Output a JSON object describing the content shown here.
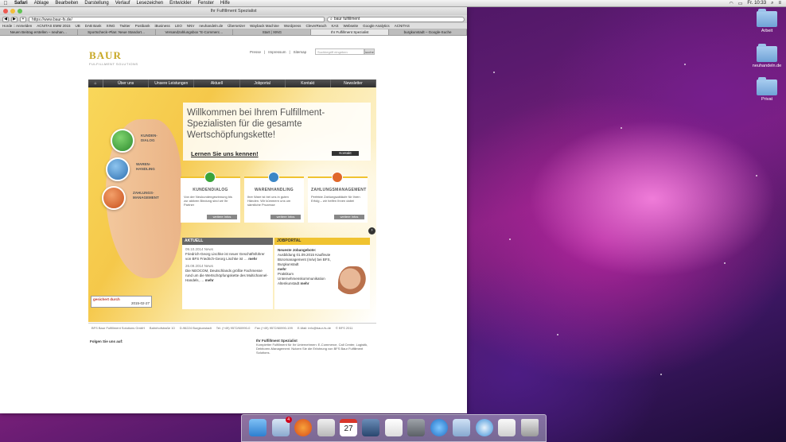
{
  "menubar": {
    "items": [
      "Safari",
      "Ablage",
      "Bearbeiten",
      "Darstellung",
      "Verlauf",
      "Lesezeichen",
      "Entwickler",
      "Fenster",
      "Hilfe"
    ],
    "clock": "Fr. 10:33"
  },
  "desktop": {
    "icons": [
      "Arbeit",
      "neuhandeln.de",
      "Privat"
    ]
  },
  "browser": {
    "title": "Ihr Fulfillment Spezialist",
    "url": "https://www.baur-fs.de/",
    "search": "baur fulfillment",
    "bookmarks": [
      "Horde :: Anmelden",
      "ACNITAS EMM 2015",
      "UB",
      "DAB Bank",
      "XING",
      "Twitter",
      "Postbank",
      "iBusiness",
      "LEO",
      "NNV",
      "neuhandeln.de",
      "Übersetzer",
      "Wayback Machine",
      "Wordpress",
      "CleverReach",
      "KAS",
      "Webseite",
      "Google Analytics",
      "ACNITAS"
    ],
    "tabs": [
      "Neuen Beitrag erstellen – neuhan…",
      "Sportscheck–Plan: Neue Standort…",
      "Versandzahlungsbox \"E-Commerc…",
      "Start | XING",
      "Ihr Fulfillment Spezialist",
      "burgkunstadt – Google-Suche"
    ]
  },
  "site": {
    "logo": "BAUR",
    "logo_sub": "FULFILLMENT SOLUTIONS",
    "toplinks": [
      "Presse",
      "Impressum",
      "Sitemap"
    ],
    "search_placeholder": "Suchbegriff eingeben",
    "search_button": "suche",
    "nav": [
      "Über uns",
      "Unsere Leistungen",
      "Aktuell",
      "Jobportal",
      "Kontakt",
      "Newsletter"
    ],
    "hero": {
      "headline": "Willkommen bei Ihrem Fulfillment-Spezialisten für die gesamte Wertschöpfungskette!",
      "learn_more": "Lernen Sie uns kennen!",
      "contact_button": "Kontakt",
      "circles": [
        {
          "label": "KUNDEN-\nDIALOG",
          "color": "#3aa33b"
        },
        {
          "label": "WAREN-\nHANDLING",
          "color": "#3b86c6"
        },
        {
          "label": "ZAHLUNGS-\nMANAGEMENT",
          "color": "#e0672a"
        }
      ]
    },
    "cards": [
      {
        "title": "KUNDENDIALOG",
        "text": "Von der Neukundengewinnung bis zur aktiven Bindung sind wir Ihr Partner",
        "more": "weitere Infos",
        "color": "#3aa33b"
      },
      {
        "title": "WARENHANDLING",
        "text": "Ihre Ware ist bei uns in guten Händen. Wir kümmern uns um sämtliche Prozesse",
        "more": "weitere Infos",
        "color": "#3b86c6"
      },
      {
        "title": "ZAHLUNGSMANAGEMENT",
        "text": "Perfekte Zahlungsabläufe für Ihren Erfolg – wir helfen Ihnen dabei",
        "more": "weitere Infos",
        "color": "#e0672a"
      }
    ],
    "news": {
      "header": "AKTUELL",
      "items": [
        {
          "date": "09.10.2014 News",
          "text": "Friedrich-Georg Lischke ist neuer Geschäftsführer von BFS Friedrich-Georg Lischke ist …",
          "more": "mehr"
        },
        {
          "date": "26.09.2014 News",
          "text": "Die NEOCOM, Deutschlands größte Fachmesse rund um die Wertschöpfungskette des Multichannel-Handels, …",
          "more": "mehr"
        }
      ]
    },
    "jobs": {
      "header": "JOBPORTAL",
      "lead": "Neueste Jobangebote:",
      "items": [
        "Ausbildung 01.09.2015 Kaufleute Büromanagement (m/w) bei BFS, Burgkunstadt",
        "mehr",
        "Praktikum Unternehmenskommunikation Altenkunstadt",
        "mehr"
      ]
    },
    "secured": {
      "line1": "gesichert durch",
      "line2": "2015-02-27"
    },
    "footer": [
      "BFS Baur Fulfillment Solutions GmbH",
      "Bahnhofstraße 10",
      "D-96224 Burgkunstadt",
      "Tel. (+49) 9572/60990-0",
      "Fax (+49) 9572/60990-199",
      "E-Mail: info@baur-fs.de",
      "© BFS 2011"
    ],
    "follow": "Folgen Sie uns auf:",
    "footdesc_title": "Ihr Fulfillment Spezialist",
    "footdesc": "Kompletter Fulfillment für Ihr Unternehmen: E-Commerce, Call Center, Logistik, Debitoren-Management. Nutzen Sie die Erfahrung von BFS Baur Fulfillment Solutions."
  },
  "dock": {
    "apps": [
      "finder-icon",
      "mail-icon",
      "firefox-icon",
      "preview-icon",
      "calendar-icon",
      "photo-icon",
      "textedit-icon",
      "system-preferences-icon",
      "itunes-icon",
      "file-icon",
      "safari-icon",
      "documents-icon",
      "trash-icon"
    ],
    "calendar_day": "27",
    "mail_badge": "4"
  }
}
